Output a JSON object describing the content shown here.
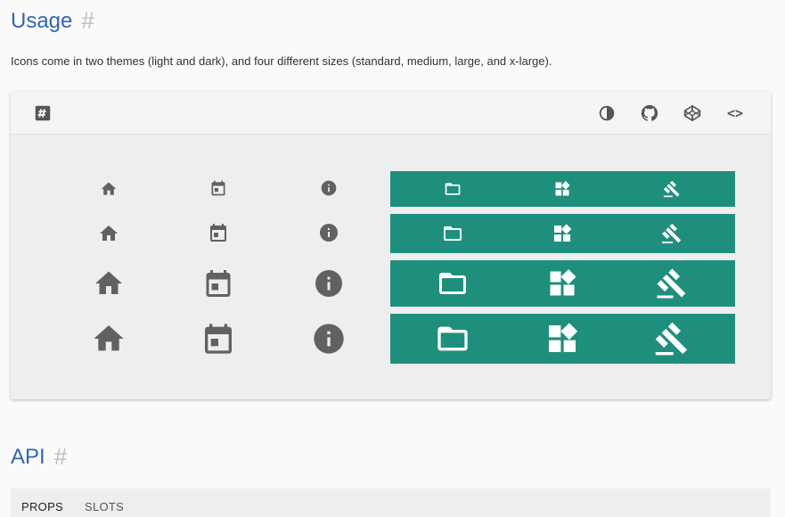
{
  "usage": {
    "title": "Usage",
    "hash": "#",
    "description": "Icons come in two themes (light and dark), and four different sizes (standard, medium, large, and x-large)."
  },
  "example": {
    "toolbar": {
      "left_icon": "hash-icon",
      "right_icons": [
        "invert-colors-icon",
        "github-icon",
        "codepen-icon",
        "code-icon"
      ],
      "code_label": "<>"
    },
    "light_icons": [
      "home-icon",
      "calendar-icon",
      "info-icon"
    ],
    "dark_icons": [
      "folder-icon",
      "widgets-icon",
      "gavel-icon"
    ],
    "sizes": [
      "standard",
      "medium",
      "large",
      "x-large"
    ],
    "dark_color": "#1f8f7d",
    "icon_color": "#616161"
  },
  "api": {
    "title": "API",
    "hash": "#",
    "tabs": [
      "PROPS",
      "SLOTS"
    ]
  }
}
